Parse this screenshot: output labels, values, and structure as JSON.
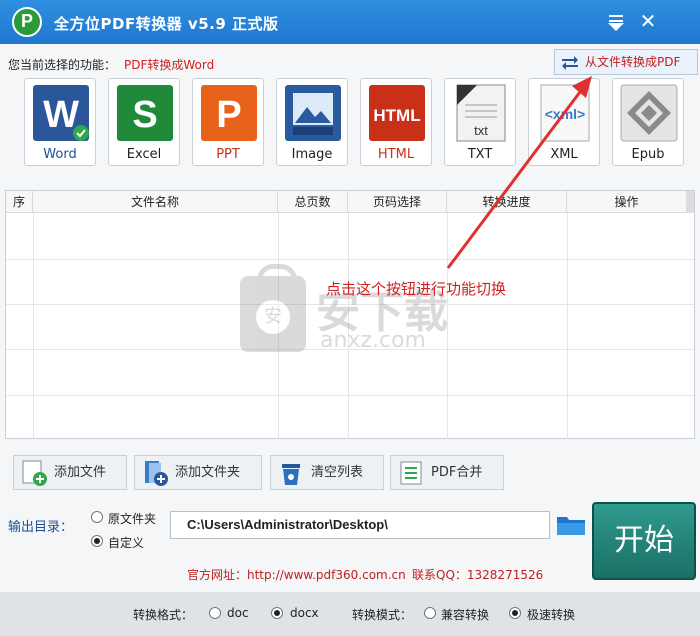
{
  "window": {
    "title": "全方位PDF转换器 v5.9 正式版"
  },
  "function_bar": {
    "label": "您当前选择的功能：",
    "value": "PDF转换成Word",
    "switch_button": "从文件转换成PDF"
  },
  "tools": [
    {
      "label": "Word",
      "icon": "word-icon",
      "color": "#2b579a",
      "selected": true
    },
    {
      "label": "Excel",
      "icon": "excel-icon",
      "color": "#1e8a3a"
    },
    {
      "label": "PPT",
      "icon": "ppt-icon",
      "color": "#e8621a"
    },
    {
      "label": "Image",
      "icon": "image-icon",
      "color": "#2a5aa0"
    },
    {
      "label": "HTML",
      "icon": "html-icon",
      "color": "#c83018"
    },
    {
      "label": "TXT",
      "icon": "txt-icon",
      "color": "#333333"
    },
    {
      "label": "XML",
      "icon": "xml-icon",
      "color": "#3a7cc8"
    },
    {
      "label": "Epub",
      "icon": "epub-icon",
      "color": "#777777"
    }
  ],
  "table": {
    "columns": [
      "序",
      "文件名称",
      "总页数",
      "页码选择",
      "转换进度",
      "操作"
    ]
  },
  "hint": "点击这个按钮进行功能切换",
  "watermark": {
    "text": "安下载",
    "sub": "anxz.com",
    "badge": "安"
  },
  "actions": [
    {
      "label": "添加文件",
      "icon": "add-file-icon"
    },
    {
      "label": "添加文件夹",
      "icon": "add-folder-icon"
    },
    {
      "label": "清空列表",
      "icon": "trash-icon"
    },
    {
      "label": "PDF合并",
      "icon": "pdf-merge-icon"
    }
  ],
  "output": {
    "label": "输出目录：",
    "option_original": "原文件夹",
    "option_custom": "自定义",
    "selected": "自定义",
    "path": "C:\\Users\\Administrator\\Desktop\\"
  },
  "start_button": "开始",
  "site": "官方网址：http://www.pdf360.com.cn",
  "qq": "联系QQ：1328271526",
  "footer": {
    "format_label": "转换格式：",
    "format_doc": "doc",
    "format_docx": "docx",
    "format_selected": "docx",
    "mode_label": "转换模式：",
    "mode_compat": "兼容转换",
    "mode_fast": "极速转换",
    "mode_selected": "极速转换"
  },
  "colors": {
    "title_bar": "#1f77cf",
    "accent_red": "#d02020",
    "start": "#2f9a8e"
  }
}
